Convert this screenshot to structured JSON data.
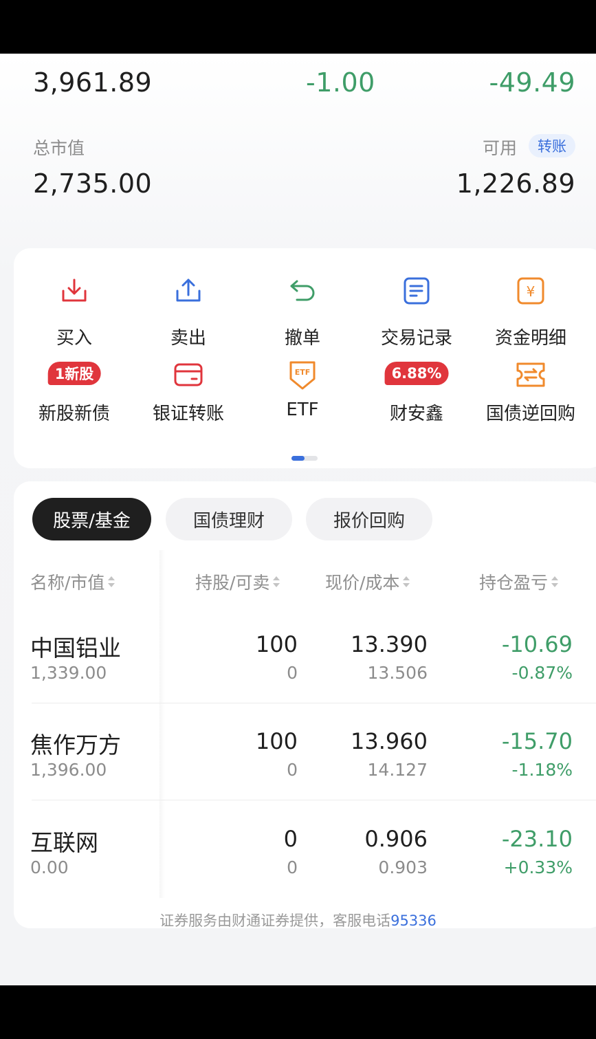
{
  "summary": {
    "total_assets": "3,961.89",
    "today_pl": "-1.00",
    "position_pl": "-49.49",
    "market_value_label": "总市值",
    "market_value": "2,735.00",
    "available_label": "可用",
    "transfer_badge": "转账",
    "available": "1,226.89"
  },
  "quick_actions": [
    {
      "label": "买入",
      "icon": "download-icon",
      "color": "#e0353c"
    },
    {
      "label": "卖出",
      "icon": "upload-icon",
      "color": "#3a6fdc"
    },
    {
      "label": "撤单",
      "icon": "undo-icon",
      "color": "#3f9d68"
    },
    {
      "label": "交易记录",
      "icon": "document-icon",
      "color": "#3a6fdc"
    },
    {
      "label": "资金明细",
      "icon": "yuan-icon",
      "color": "#f08a2c"
    },
    {
      "label": "新股新债",
      "icon": "new-ipo-badge",
      "badge": "1新股",
      "color": "#e0353c"
    },
    {
      "label": "银证转账",
      "icon": "card-icon",
      "color": "#e0353c"
    },
    {
      "label": "ETF",
      "icon": "etf-shield-icon",
      "color": "#f08a2c"
    },
    {
      "label": "财安鑫",
      "icon": "rate-badge",
      "badge": "6.88%",
      "color": "#e0353c"
    },
    {
      "label": "国债逆回购",
      "icon": "exchange-ticket-icon",
      "color": "#f08a2c"
    }
  ],
  "tabs": [
    {
      "label": "股票/基金",
      "active": true
    },
    {
      "label": "国债理财",
      "active": false
    },
    {
      "label": "报价回购",
      "active": false
    }
  ],
  "columns": [
    "名称/市值",
    "持股/可卖",
    "现价/成本",
    "持仓盈亏"
  ],
  "holdings": [
    {
      "name": "中国铝业",
      "market_value": "1,339.00",
      "shares": "100",
      "sellable": "0",
      "price": "13.390",
      "cost": "13.506",
      "pl": "-10.69",
      "pl_pct": "-0.87%"
    },
    {
      "name": "焦作万方",
      "market_value": "1,396.00",
      "shares": "100",
      "sellable": "0",
      "price": "13.960",
      "cost": "14.127",
      "pl": "-15.70",
      "pl_pct": "-1.18%"
    },
    {
      "name": "互联网",
      "market_value": "0.00",
      "shares": "0",
      "sellable": "0",
      "price": "0.906",
      "cost": "0.903",
      "pl": "-23.10",
      "pl_pct": "+0.33%"
    }
  ],
  "footer": {
    "text": "证券服务由财通证券提供，客服电话",
    "phone": "95336"
  }
}
